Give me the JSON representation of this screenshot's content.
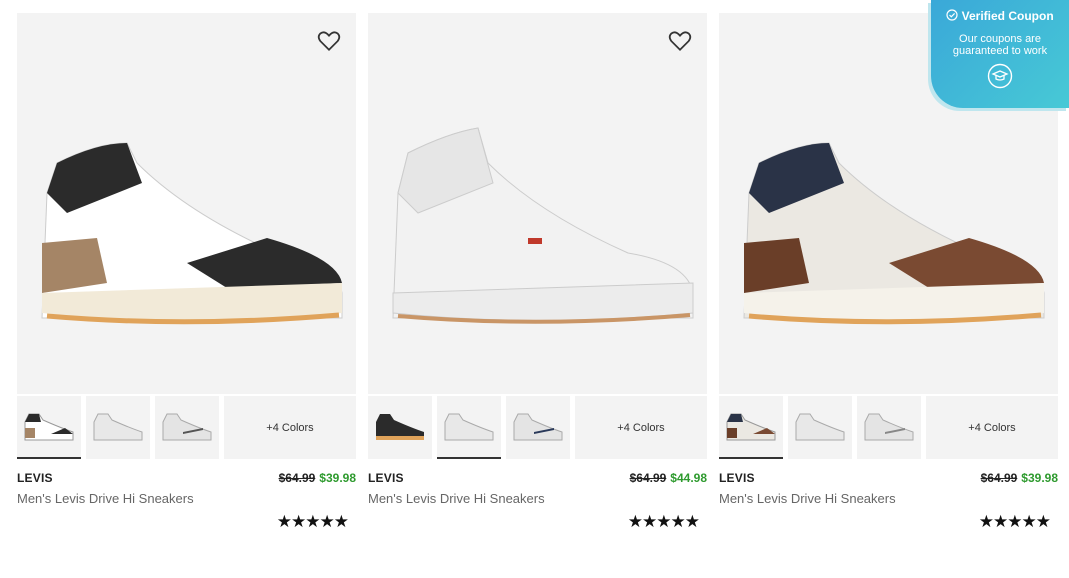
{
  "products": [
    {
      "brand": "LEVIS",
      "name": "Men's Levis Drive Hi Sneakers",
      "old_price": "$64.99",
      "price": "$39.98",
      "more_colors": "+4 Colors",
      "rating_stars": "★★★★★",
      "rating": 4.5,
      "colors": {
        "upper": "#ffffff",
        "accent": "#2b2b2b",
        "heel": "#a58566",
        "sole": "#f2ead8"
      }
    },
    {
      "brand": "LEVIS",
      "name": "Men's Levis Drive Hi Sneakers",
      "old_price": "$64.99",
      "price": "$44.98",
      "more_colors": "+4 Colors",
      "rating_stars": "★★★★★",
      "rating": 4.5,
      "colors": {
        "upper": "#f2f2f2",
        "accent": "#e6e6e6",
        "heel": "#e8e8e8",
        "sole": "#ececec"
      }
    },
    {
      "brand": "LEVIS",
      "name": "Men's Levis Drive Hi Sneakers",
      "old_price": "$64.99",
      "price": "$39.98",
      "more_colors": "+4 Colors",
      "rating_stars": "★★★★★",
      "rating": 4.5,
      "colors": {
        "upper": "#ebe8e2",
        "accent": "#7a4a32",
        "heel": "#6a3e28",
        "sole": "#f5f2ea"
      }
    }
  ],
  "coupon": {
    "title": "Verified Coupon",
    "subtitle": "Our coupons are guaranteed to work"
  },
  "icons": {
    "favorite": "heart-icon",
    "verified": "check-circle-icon",
    "coupon": "graduation-cap-icon"
  },
  "colors": {
    "sale": "#2e9a2e",
    "coupon_bg": "#3aa8d8"
  }
}
